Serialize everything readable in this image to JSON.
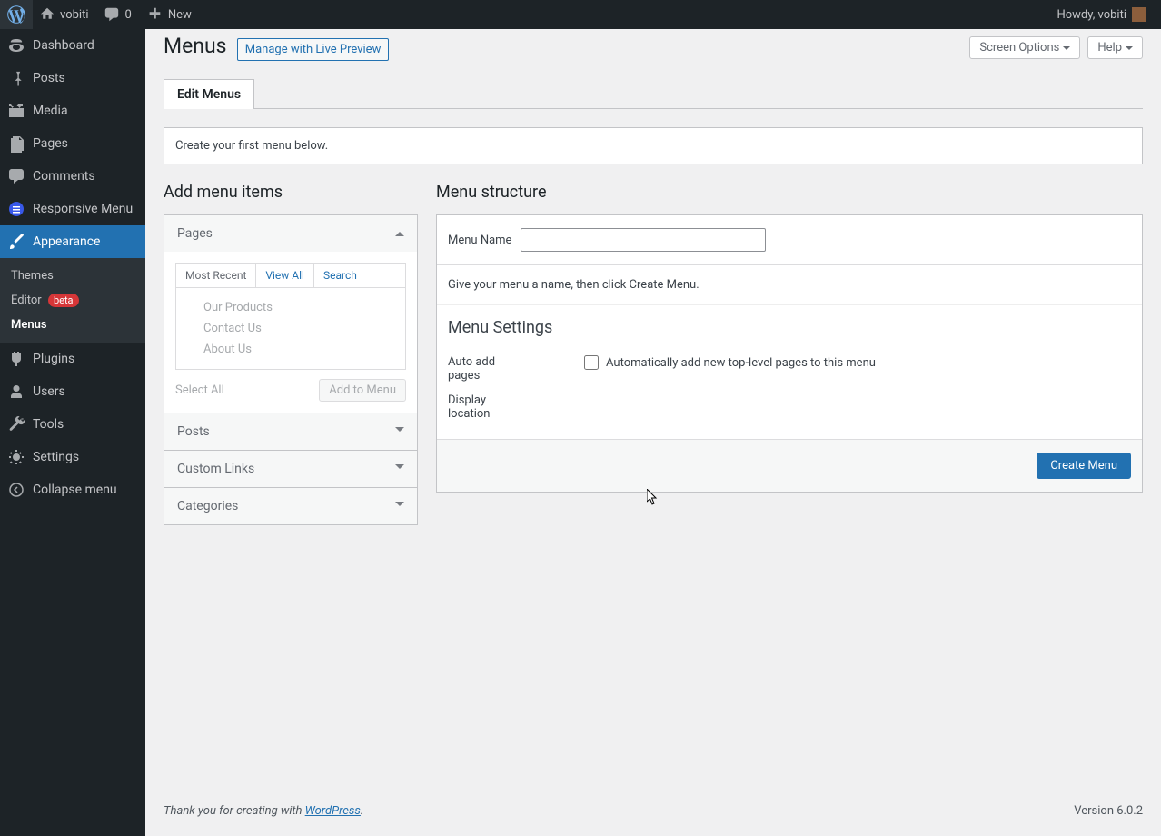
{
  "adminbar": {
    "site_name": "vobiti",
    "comments": "0",
    "new": "New",
    "howdy": "Howdy, vobiti"
  },
  "sidebar": {
    "dashboard": "Dashboard",
    "posts": "Posts",
    "media": "Media",
    "pages": "Pages",
    "comments": "Comments",
    "responsive_menu": "Responsive Menu",
    "appearance": "Appearance",
    "themes": "Themes",
    "editor": "Editor",
    "editor_badge": "beta",
    "menus": "Menus",
    "plugins": "Plugins",
    "users": "Users",
    "tools": "Tools",
    "settings": "Settings",
    "collapse": "Collapse menu"
  },
  "screen": {
    "options": "Screen Options",
    "help": "Help"
  },
  "page": {
    "title": "Menus",
    "live_preview": "Manage with Live Preview",
    "tab_edit": "Edit Menus",
    "notice": "Create your first menu below."
  },
  "left": {
    "heading": "Add menu items",
    "pages": "Pages",
    "most_recent": "Most Recent",
    "view_all": "View All",
    "search": "Search",
    "items": [
      "Our Products",
      "Contact Us",
      "About Us"
    ],
    "select_all": "Select All",
    "add_to_menu": "Add to Menu",
    "posts": "Posts",
    "custom_links": "Custom Links",
    "categories": "Categories"
  },
  "right": {
    "heading": "Menu structure",
    "menu_name_label": "Menu Name",
    "menu_name_value": "",
    "instructions": "Give your menu a name, then click Create Menu.",
    "settings_title": "Menu Settings",
    "auto_add_label": "Auto add pages",
    "auto_add_desc": "Automatically add new top-level pages to this menu",
    "display_location": "Display location",
    "create_menu": "Create Menu"
  },
  "footer": {
    "thanks_prefix": "Thank you for creating with ",
    "wordpress": "WordPress",
    "version": "Version 6.0.2"
  }
}
